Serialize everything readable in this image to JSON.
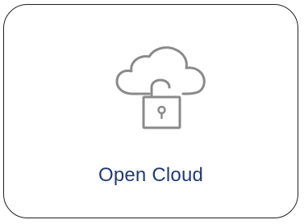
{
  "card": {
    "label": "Open Cloud",
    "icon": "cloud-unlock-icon",
    "colors": {
      "label": "#233a73",
      "icon_stroke": "#8a8a8a",
      "border": "#1f1f1f"
    }
  }
}
